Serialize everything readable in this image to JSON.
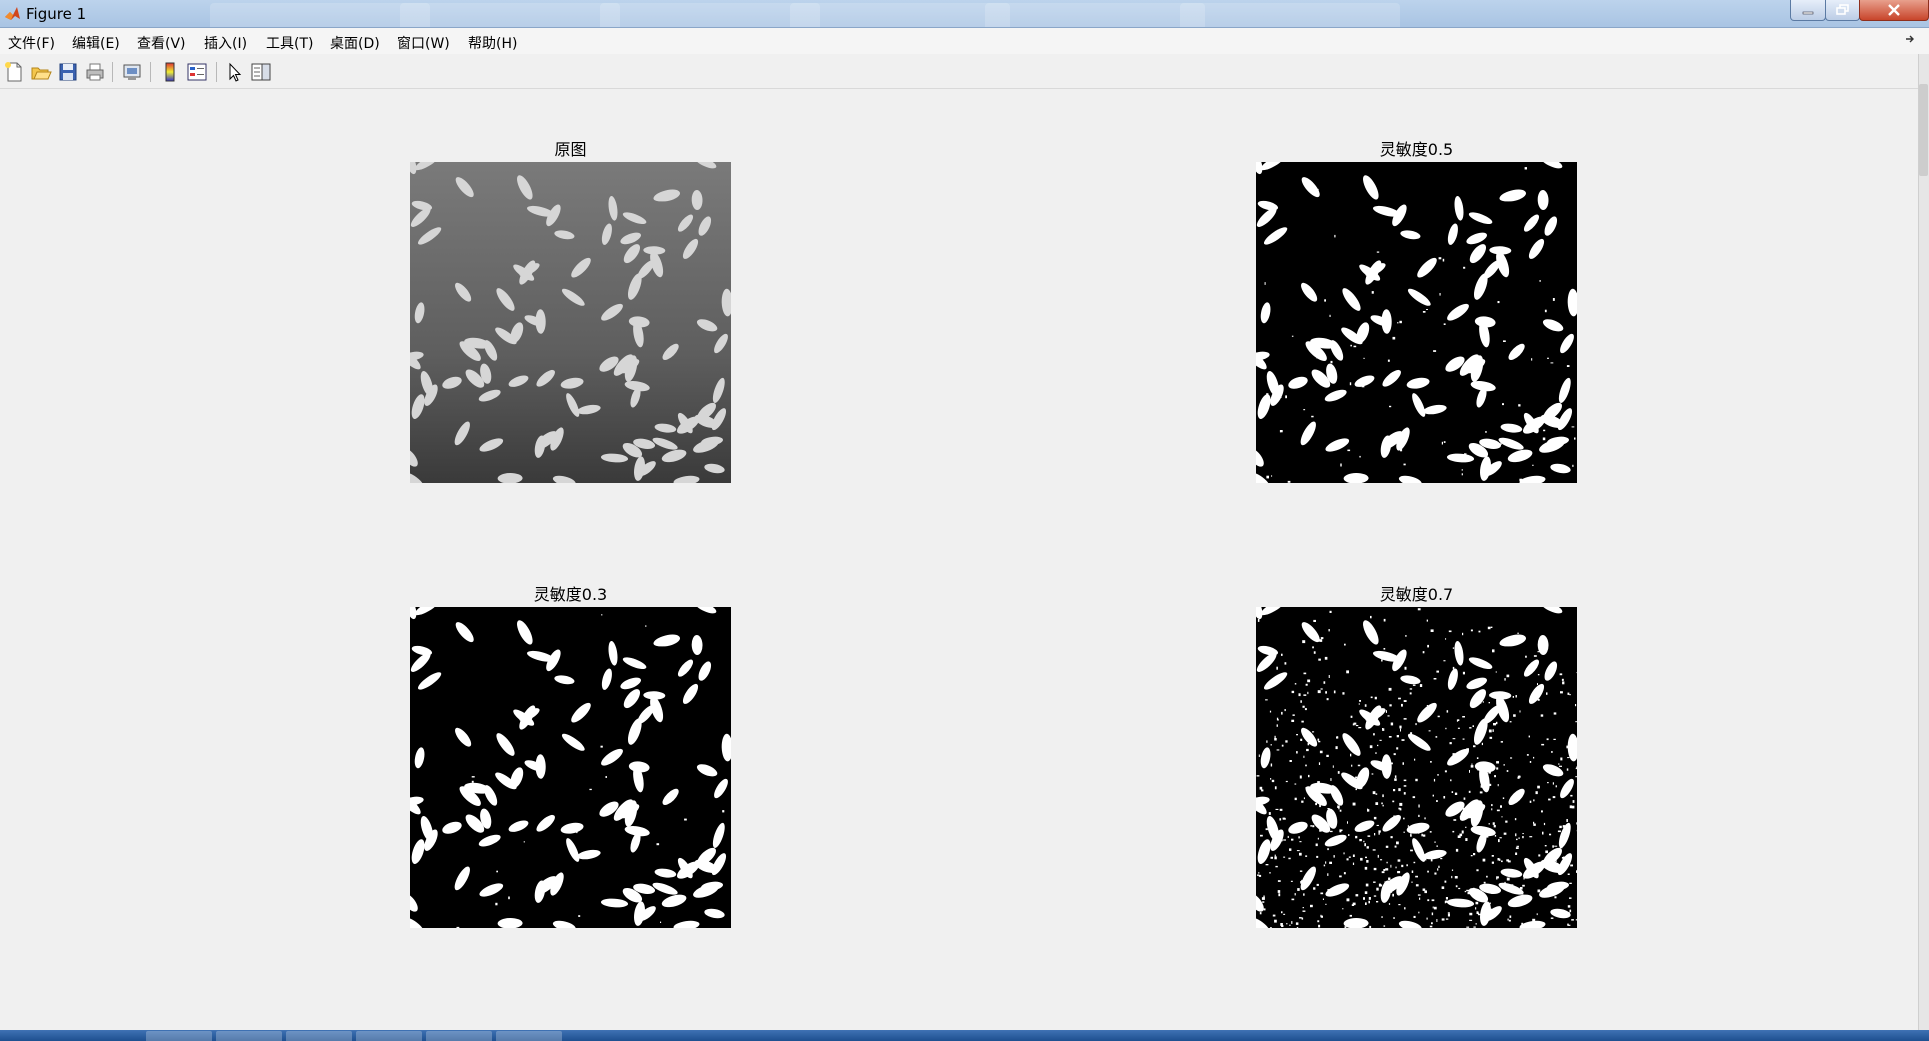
{
  "window": {
    "title": "Figure 1"
  },
  "menu": [
    "文件(F)",
    "编辑(E)",
    "查看(V)",
    "插入(I)",
    "工具(T)",
    "桌面(D)",
    "窗口(W)",
    "帮助(H)"
  ],
  "toolbar": [
    {
      "icon": "new-figure-icon"
    },
    {
      "icon": "open-file-icon"
    },
    {
      "icon": "save-icon"
    },
    {
      "icon": "print-icon"
    },
    {
      "icon": "print-preview-icon"
    },
    {
      "icon": "colorbar-icon"
    },
    {
      "icon": "legend-icon"
    },
    {
      "icon": "edit-plot-arrow-icon"
    },
    {
      "icon": "property-editor-icon"
    }
  ],
  "subplots": [
    {
      "title": "原图",
      "mode": "grayscale"
    },
    {
      "title": "灵敏度0.5",
      "mode": "binary",
      "noise": 0.02
    },
    {
      "title": "灵敏度0.3",
      "mode": "binary",
      "noise": 0.005
    },
    {
      "title": "灵敏度0.7",
      "mode": "binary",
      "noise": 0.18
    }
  ],
  "colors": {
    "background": "#f0f0f0",
    "grain": "#ffffff",
    "binary_bg": "#000000",
    "gray_bg": "#6e6e6e"
  }
}
